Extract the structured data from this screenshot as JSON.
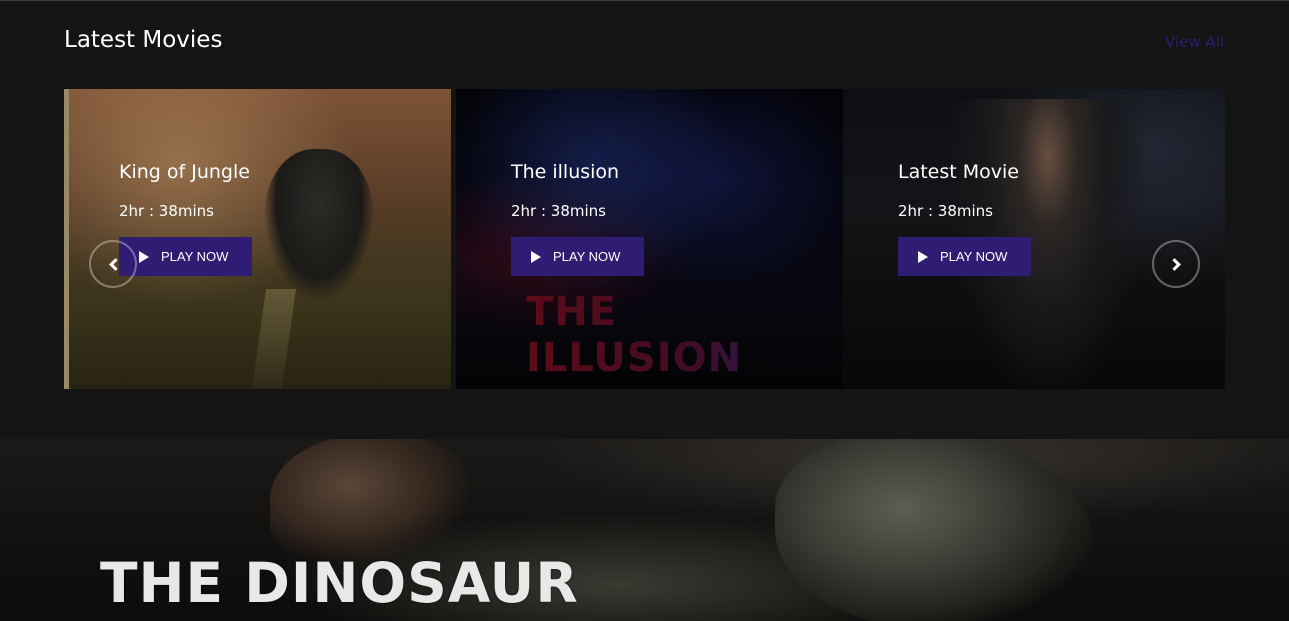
{
  "section": {
    "title": "Latest Movies",
    "view_all": "View All"
  },
  "carousel": {
    "cards": [
      {
        "title": "King of Jungle",
        "duration": "2hr : 38mins",
        "play_label": "PLAY NOW"
      },
      {
        "title": "The illusion",
        "duration": "2hr : 38mins",
        "play_label": "PLAY NOW",
        "poster_text": "THE ILLUSION"
      },
      {
        "title": "Latest Movie",
        "duration": "2hr : 38mins",
        "play_label": "PLAY NOW"
      }
    ]
  },
  "banner": {
    "title": "THE DINOSAUR"
  },
  "colors": {
    "accent": "#2e1d72",
    "background": "#141414",
    "text": "#ffffff"
  },
  "icons": [
    "play-icon",
    "chevron-left-icon",
    "chevron-right-icon"
  ]
}
